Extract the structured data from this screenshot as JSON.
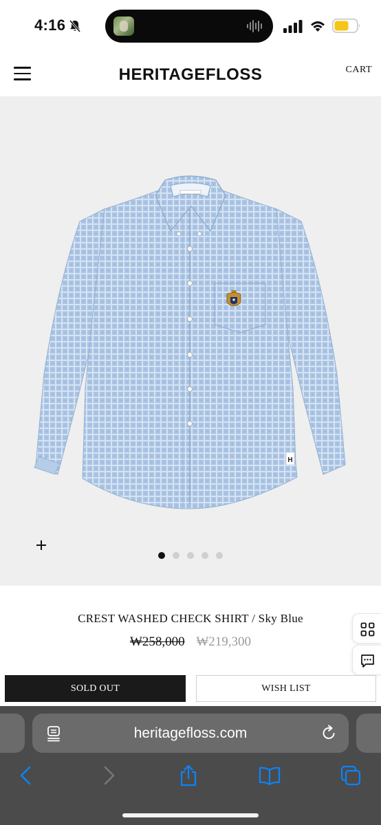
{
  "status_bar": {
    "time": "4:16",
    "icons": [
      "bell-slash-icon",
      "cellular-signal-icon",
      "wifi-icon",
      "battery-icon"
    ],
    "battery_color": "#f5c518"
  },
  "header": {
    "menu_icon": "hamburger-menu-icon",
    "brand": "HERITAGEFLOSS",
    "cart_label": "CART"
  },
  "gallery": {
    "image_alt": "shirt-image",
    "zoom_icon": "plus-icon",
    "slide_count": 5,
    "active_slide": 1,
    "background": "#efefef"
  },
  "product": {
    "title": "CREST WASHED CHECK SHIRT / Sky Blue",
    "original_price": "₩258,000",
    "sale_price": "₩219,300"
  },
  "side_tabs": [
    "grid-icon",
    "chat-icon"
  ],
  "actions": {
    "sold_out_label": "SOLD OUT",
    "wish_list_label": "WISH LIST"
  },
  "browser": {
    "url": "heritagefloss.com",
    "icons": [
      "reader-mode-icon",
      "reload-icon",
      "back-icon",
      "forward-icon",
      "share-icon",
      "bookmarks-icon",
      "tabs-icon"
    ],
    "accent": "#0a84ff"
  }
}
